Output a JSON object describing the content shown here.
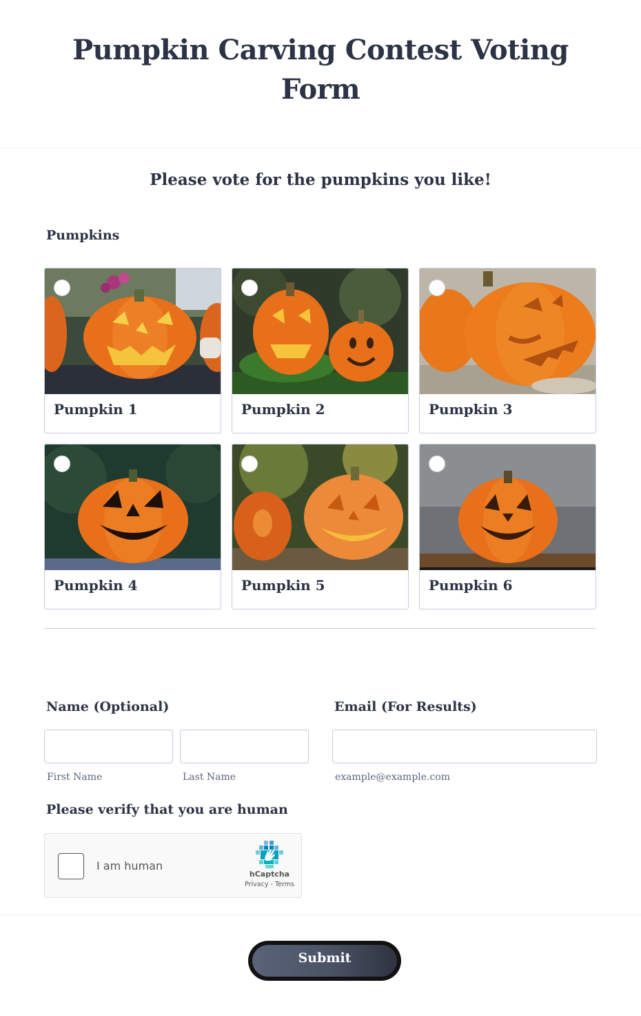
{
  "form": {
    "title": "Pumpkin Carving Contest Voting Form",
    "subtitle": "Please vote for the pumpkins you like!"
  },
  "pumpkins": {
    "label": "Pumpkins",
    "options": [
      {
        "label": "Pumpkin 1",
        "selected": false
      },
      {
        "label": "Pumpkin 2",
        "selected": false
      },
      {
        "label": "Pumpkin 3",
        "selected": false
      },
      {
        "label": "Pumpkin 4",
        "selected": false
      },
      {
        "label": "Pumpkin 5",
        "selected": false
      },
      {
        "label": "Pumpkin 6",
        "selected": false
      }
    ]
  },
  "name": {
    "label": "Name (Optional)",
    "first_value": "",
    "last_value": "",
    "first_sublabel": "First Name",
    "last_sublabel": "Last Name"
  },
  "email": {
    "label": "Email (For Results)",
    "value": "",
    "sublabel": "example@example.com"
  },
  "verify": {
    "label": "Please verify that you are human",
    "checkbox_text": "I am human",
    "brand": "hCaptcha",
    "legal": "Privacy - Terms",
    "checked": false
  },
  "submit": {
    "label": "Submit"
  },
  "colors": {
    "text": "#2c3345",
    "border": "#c3cad8",
    "sublabel": "#57647e",
    "pumpkin": "#e8701a"
  }
}
